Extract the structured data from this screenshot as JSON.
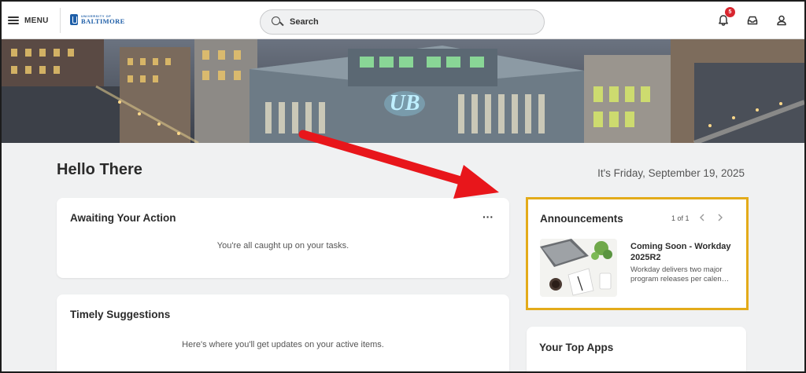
{
  "header": {
    "menu_label": "MENU",
    "logo_small": "UNIVERSITY OF",
    "logo_big": "BALTIMORE",
    "search_placeholder": "Search",
    "notification_count": "5",
    "icons": [
      "hamburger-icon",
      "search-icon",
      "bell-icon",
      "inbox-icon",
      "profile-icon"
    ]
  },
  "hero": {
    "building_logo": "UB"
  },
  "main": {
    "greeting": "Hello There",
    "date": "It's Friday, September 19, 2025"
  },
  "awaiting": {
    "title": "Awaiting Your Action",
    "more_label": "···",
    "message": "You're all caught up on your tasks."
  },
  "timely": {
    "title": "Timely Suggestions",
    "message": "Here's where you'll get updates on your active items."
  },
  "announcements": {
    "title": "Announcements",
    "pager": "1 of 1",
    "items": [
      {
        "headline_line1": "Coming Soon - Workday",
        "headline_line2": "2025R2",
        "body_line1": "Workday delivers two major",
        "body_line2": "program releases per calen…"
      }
    ],
    "highlight_color": "#e3ab1a"
  },
  "top_apps": {
    "title": "Your Top Apps"
  },
  "colors": {
    "annotation_arrow": "#e8161b",
    "badge": "#d8262f",
    "brand": "#1f5fa8"
  }
}
